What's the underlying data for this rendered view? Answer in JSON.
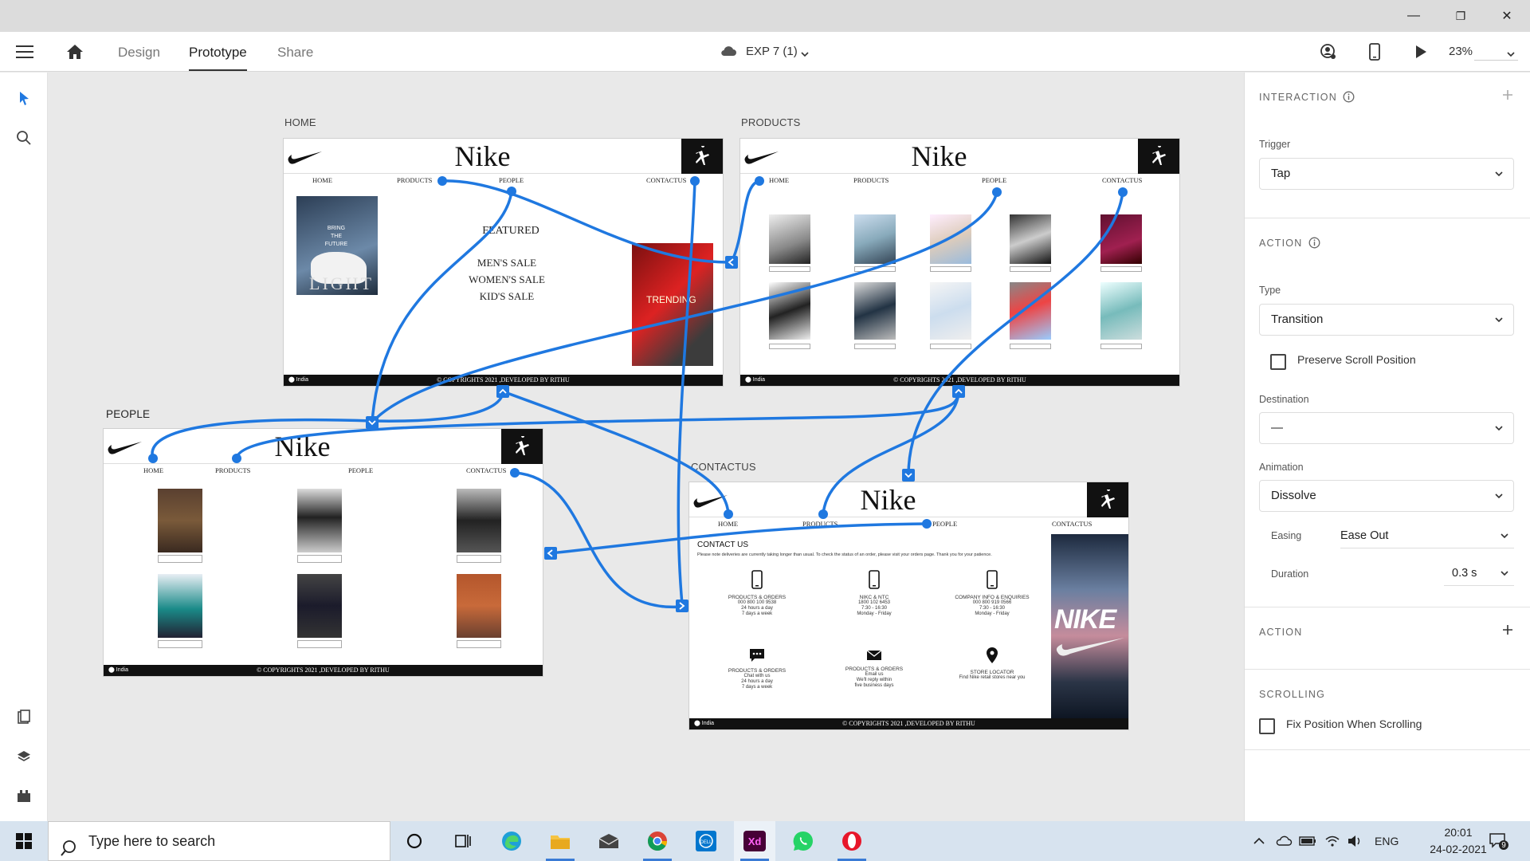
{
  "window": {
    "minimize_glyph": "—",
    "maximize_glyph": "❐",
    "close_glyph": "✕"
  },
  "app": {
    "tabs": [
      {
        "label": "Design",
        "active": false
      },
      {
        "label": "Prototype",
        "active": true
      },
      {
        "label": "Share",
        "active": false
      }
    ],
    "doc_name": "EXP 7 (1)",
    "zoom": "23%"
  },
  "artboards": {
    "home": {
      "title": "HOME",
      "brand": "Nike",
      "menu": [
        "HOME",
        "PRODUCTS",
        "PEOPLE",
        "CONTACTUS"
      ],
      "poster_line1": "BRING",
      "poster_line2": "THE",
      "poster_line3": "FUTURE",
      "poster_big": "LIGHT",
      "featured": "FEATURED",
      "sales": [
        "MEN'S SALE",
        "WOMEN'S SALE",
        "KID'S SALE"
      ],
      "trending": "TRENDING",
      "footer_loc": "India",
      "footer_copy": "COPYRIGHTS 2021 ,DEVELOPED BY RITHU"
    },
    "products": {
      "title": "PRODUCTS",
      "brand": "Nike",
      "menu": [
        "HOME",
        "PRODUCTS",
        "PEOPLE",
        "CONTACTUS"
      ],
      "footer_loc": "India",
      "footer_copy": "COPYRIGHTS 2021 ,DEVELOPED BY RITHU"
    },
    "people": {
      "title": "PEOPLE",
      "brand": "Nike",
      "menu": [
        "HOME",
        "PRODUCTS",
        "PEOPLE",
        "CONTACTUS"
      ],
      "footer_loc": "India",
      "footer_copy": "COPYRIGHTS 2021 ,DEVELOPED BY RITHU"
    },
    "contact": {
      "title": "CONTACTUS",
      "brand": "Nike",
      "menu": [
        "HOME",
        "PRODUCTS",
        "PEOPLE",
        "CONTACTUS"
      ],
      "heading": "CONTACT US",
      "note": "Please note deliveries are currently taking longer than usual. To check the status of an order, please visit your orders page. Thank you for your patience.",
      "items": [
        {
          "title": "PRODUCTS & ORDERS",
          "l1": "000 800 100 9538",
          "l2": "24 hours a day",
          "l3": "7 days a week"
        },
        {
          "title": "NIKC & NTC",
          "l1": "1800 102 6453",
          "l2": "7:30 - 16:30",
          "l3": "Monday - Friday"
        },
        {
          "title": "COMPANY INFO & ENQUIRIES",
          "l1": "000 800 919 0566",
          "l2": "7:30 - 16:30",
          "l3": "Monday - Friday"
        },
        {
          "title": "PRODUCTS & ORDERS",
          "l1": "Chat with us",
          "l2": "24 hours a day",
          "l3": "7 days a week"
        },
        {
          "title": "PRODUCTS & ORDERS",
          "l1": "Email us",
          "l2": "We'll reply within",
          "l3": "five business days"
        },
        {
          "title": "STORE LOCATOR",
          "l1": "Find Nike retail stores near you",
          "l2": "",
          "l3": ""
        }
      ],
      "side_brand": "NIKE",
      "footer_loc": "India",
      "footer_copy": "COPYRIGHTS 2021 ,DEVELOPED BY RITHU"
    }
  },
  "panel": {
    "interaction_title": "INTERACTION",
    "trigger_label": "Trigger",
    "trigger_value": "Tap",
    "action_title": "ACTION",
    "type_label": "Type",
    "type_value": "Transition",
    "preserve_scroll": "Preserve Scroll Position",
    "destination_label": "Destination",
    "destination_value": "—",
    "animation_label": "Animation",
    "animation_value": "Dissolve",
    "easing_label": "Easing",
    "easing_value": "Ease Out",
    "duration_label": "Duration",
    "duration_value": "0.3 s",
    "action2_title": "ACTION",
    "scrolling_title": "SCROLLING",
    "fix_position": "Fix Position When Scrolling"
  },
  "taskbar": {
    "search_placeholder": "Type here to search",
    "language": "ENG",
    "time": "20:01",
    "date": "24-02-2021",
    "notifications": "9"
  },
  "colors": {
    "accent": "#1f78e0",
    "nike_black": "#111111"
  }
}
